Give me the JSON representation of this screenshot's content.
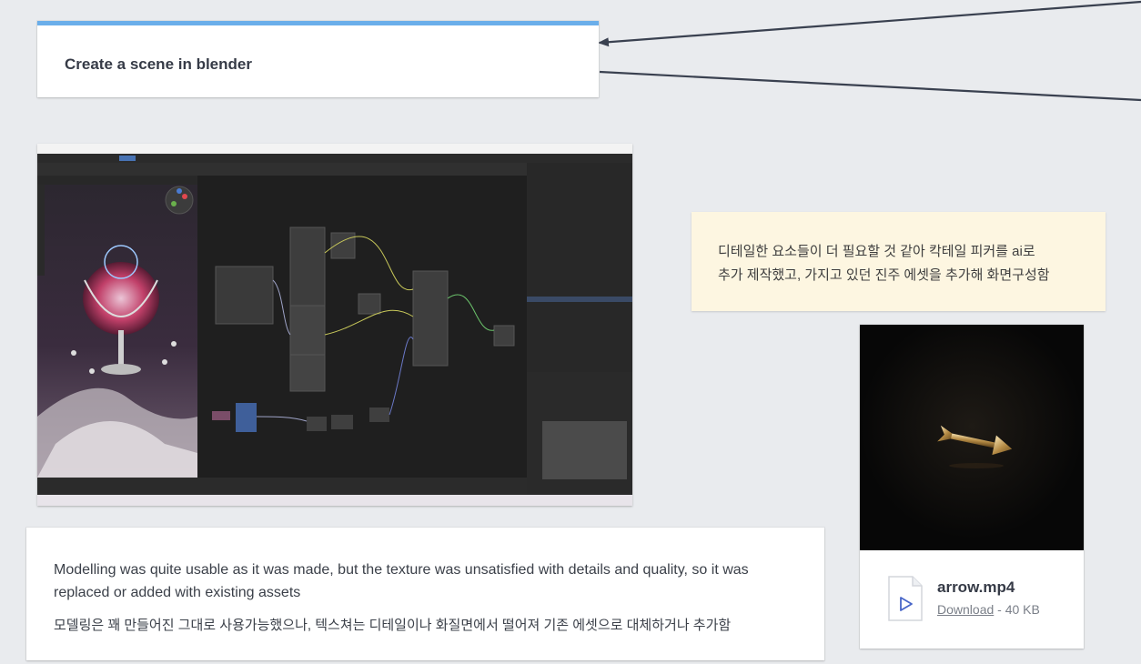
{
  "title_card": {
    "title": "Create a scene in blender"
  },
  "note_card": {
    "line1": "디테일한 요소들이 더 필요할 것 같아 칵테일 피커를 ai로",
    "line2": "추가 제작했고, 가지고 있던 진주 에셋을 추가해 화면구성함"
  },
  "file_card": {
    "filename": "arrow.mp4",
    "download_label": "Download",
    "size": " - 40 KB"
  },
  "text_card": {
    "english": "Modelling was quite usable as it was made, but the texture was unsatisfied with details and quality, so it was replaced or added with existing assets",
    "korean": "모델링은 꽤 만들어진 그대로 사용가능했으나, 텍스쳐는 디테일이나 화질면에서 떨어져 기존 에셋으로 대체하거나 추가함"
  },
  "colors": {
    "accent_bar": "#6aaeea",
    "note_bg": "#fdf6e1",
    "canvas_bg": "#e9ebee"
  },
  "icons": [
    "video-file-icon",
    "play-icon"
  ]
}
